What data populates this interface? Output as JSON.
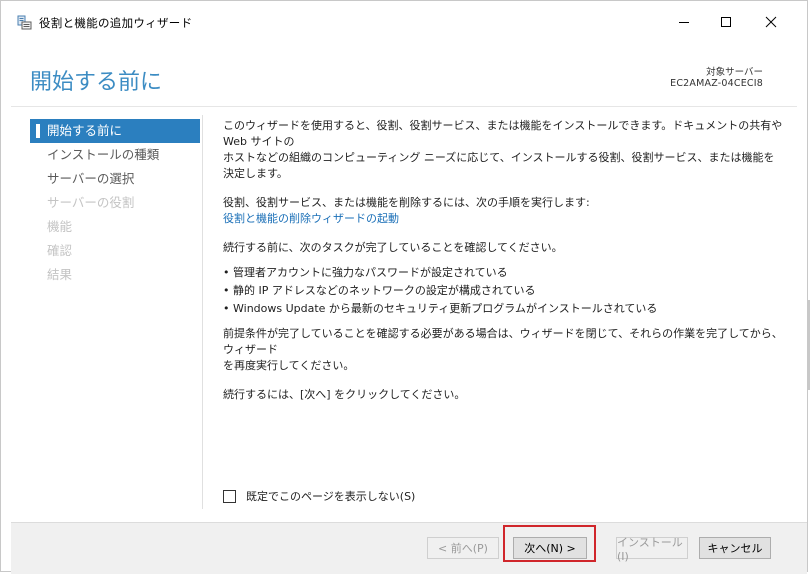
{
  "window": {
    "title": "役割と機能の追加ウィザード"
  },
  "header": {
    "page_title": "開始する前に",
    "target_label": "対象サーバー",
    "target_server": "EC2AMAZ-04CECI8"
  },
  "nav": {
    "items": [
      {
        "label": "開始する前に",
        "state": "active"
      },
      {
        "label": "インストールの種類",
        "state": "enabled"
      },
      {
        "label": "サーバーの選択",
        "state": "enabled"
      },
      {
        "label": "サーバーの役割",
        "state": "disabled"
      },
      {
        "label": "機能",
        "state": "disabled"
      },
      {
        "label": "確認",
        "state": "disabled"
      },
      {
        "label": "結果",
        "state": "disabled"
      }
    ]
  },
  "content": {
    "intro_line1": "このウィザードを使用すると、役割、役割サービス、または機能をインストールできます。ドキュメントの共有や Web サイトの",
    "intro_line2": "ホストなどの組織のコンピューティング ニーズに応じて、インストールする役割、役割サービス、または機能を決定します。",
    "remove_text": "役割、役割サービス、または機能を削除するには、次の手順を実行します:",
    "remove_link": "役割と機能の削除ウィザードの起動",
    "tasks_intro": "続行する前に、次のタスクが完了していることを確認してください。",
    "tasks": [
      "管理者アカウントに強力なパスワードが設定されている",
      "静的 IP アドレスなどのネットワークの設定が構成されている",
      "Windows Update から最新のセキュリティ更新プログラムがインストールされている"
    ],
    "prereq_line1": "前提条件が完了していることを確認する必要がある場合は、ウィザードを閉じて、それらの作業を完了してから、ウィザード",
    "prereq_line2": "を再度実行してください。",
    "continue_text": "続行するには、[次へ] をクリックしてください。",
    "skip_checkbox_label": "既定でこのページを表示しない(S)",
    "skip_checkbox_checked": false
  },
  "footer": {
    "prev_label": "< 前へ(P)",
    "next_label": "次へ(N) >",
    "install_label": "インストール(I)",
    "cancel_label": "キャンセル"
  },
  "colors": {
    "accent": "#2b7fbf",
    "title": "#3c8cc3",
    "link": "#1a6fb7",
    "highlight": "#d0262b"
  }
}
